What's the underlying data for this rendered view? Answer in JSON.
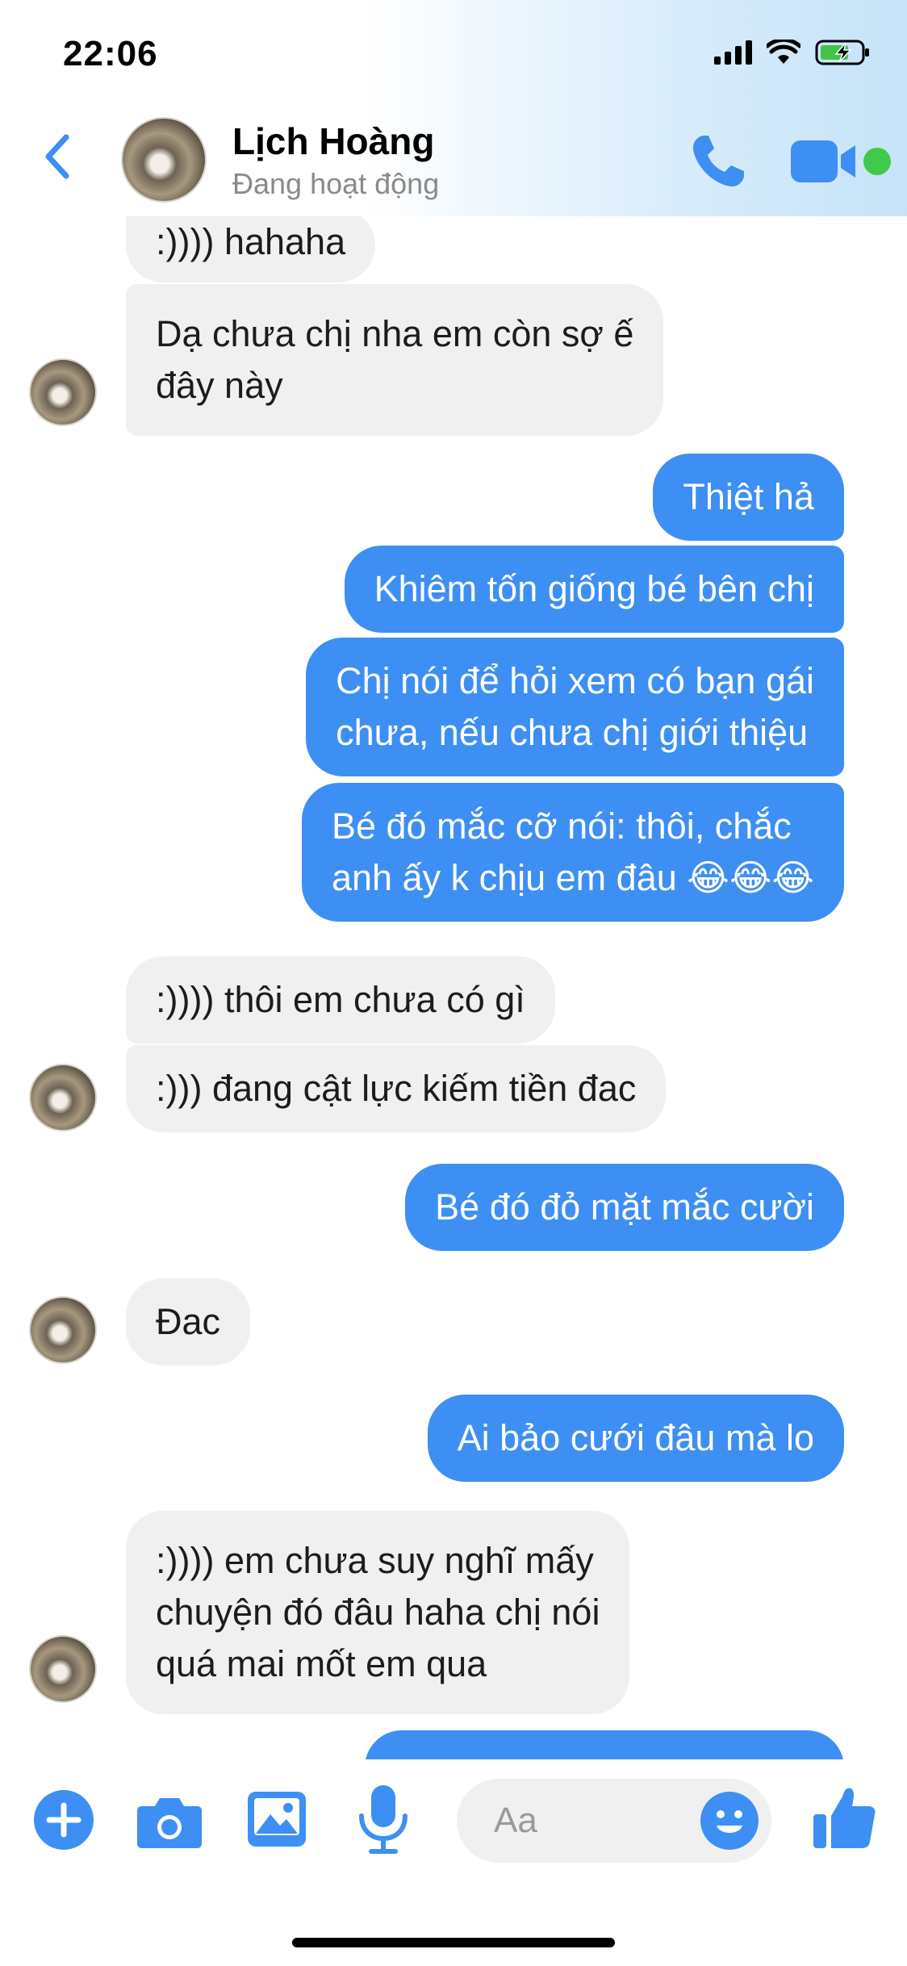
{
  "status_bar": {
    "time": "22:06"
  },
  "header": {
    "name": "Lịch Hoàng",
    "status": "Đang hoạt động"
  },
  "messages": [
    {
      "side": "in",
      "text": ":)))) hahaha"
    },
    {
      "side": "in",
      "text": "Dạ chưa chị nha em còn sợ ế\nđây này"
    },
    {
      "side": "out",
      "text": "Thiệt hả"
    },
    {
      "side": "out",
      "text": "Khiêm tốn giống bé bên chị"
    },
    {
      "side": "out",
      "text": "Chị nói để hỏi xem có bạn gái\nchưa, nếu chưa chị giới thiệu"
    },
    {
      "side": "out",
      "text": "Bé đó mắc cỡ nói: thôi, chắc\nanh ấy k chịu em đâu 😂😂😂"
    },
    {
      "side": "in",
      "text": ":)))) thôi em chưa có gì"
    },
    {
      "side": "in",
      "text": ":))) đang  cật lực kiếm tiền đac"
    },
    {
      "side": "out",
      "text": "Bé đó đỏ mặt mắc cười"
    },
    {
      "side": "in",
      "text": "Đac"
    },
    {
      "side": "out",
      "text": "Ai bảo cưới đâu mà lo"
    },
    {
      "side": "in",
      "text": ":)))) em chưa suy nghĩ mấy\nchuyện đó đâu haha chị nói\nquá mai mốt em qua"
    },
    {
      "side": "out",
      "text": ""
    }
  ],
  "composer": {
    "placeholder": "Aa"
  },
  "colors": {
    "accent": "#3d8ff3",
    "incoming_bubble": "#f0f0f0",
    "online": "#40c94b"
  },
  "icons": {
    "back": "chevron-left-icon",
    "call": "phone-icon",
    "video": "video-camera-icon",
    "plus": "plus-icon",
    "camera": "camera-icon",
    "image": "image-icon",
    "mic": "microphone-icon",
    "emoji": "emoji-icon",
    "like": "thumbs-up-icon"
  }
}
